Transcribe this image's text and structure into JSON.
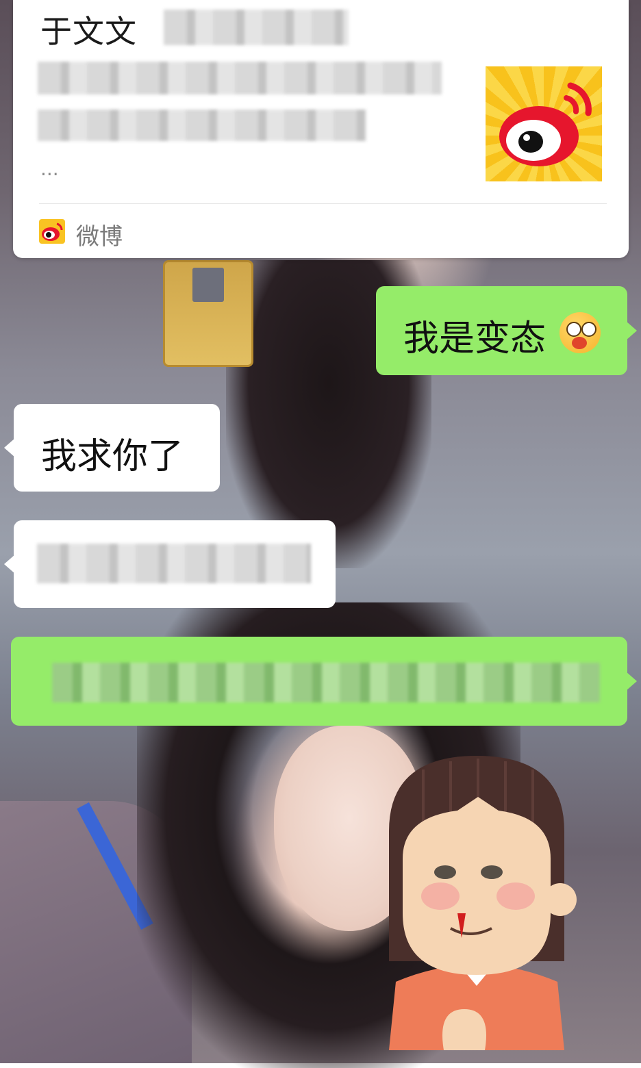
{
  "link_card": {
    "title": "于文文",
    "description_visible": "",
    "ellipsis": "...",
    "source_label": "微博",
    "source_icon": "weibo-icon",
    "thumbnail_icon": "weibo-logo-icon"
  },
  "messages": [
    {
      "side": "right",
      "text": "我是变态",
      "emoji": "starstruck-face-emoji"
    },
    {
      "side": "left",
      "text": "我求你了"
    },
    {
      "side": "left",
      "text": ""
    },
    {
      "side": "right",
      "text": ""
    }
  ],
  "colors": {
    "outgoing_bubble": "#95ec69",
    "incoming_bubble": "#ffffff",
    "weibo_yellow": "#f9c323",
    "weibo_red": "#e6162d"
  },
  "sticker": {
    "icon": "nosebleed-girl-sticker"
  }
}
